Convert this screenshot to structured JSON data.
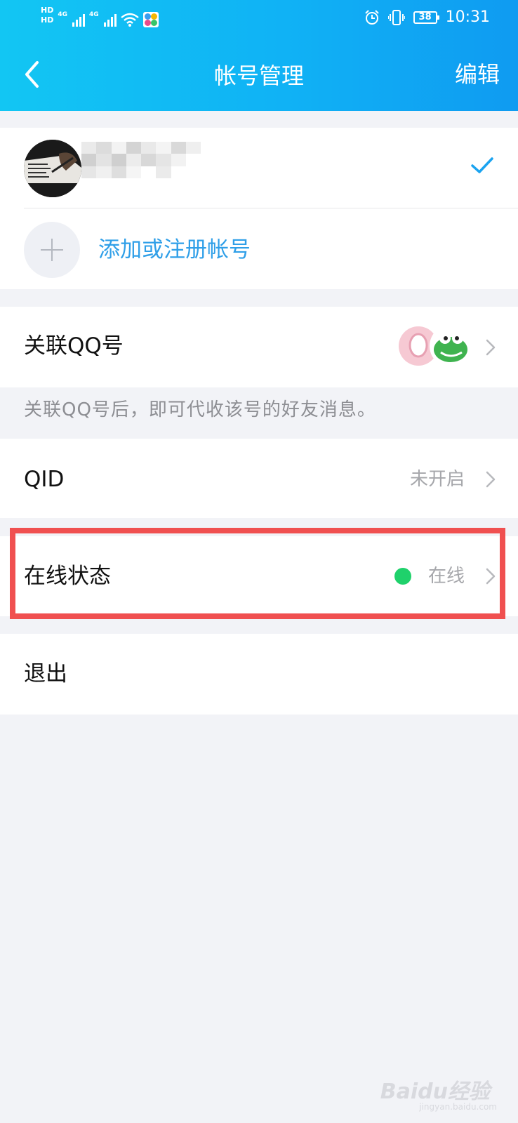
{
  "status_bar": {
    "hd1": "HD",
    "hd2": "HD",
    "net1": "4G",
    "net2": "4G",
    "battery": "38",
    "time": "10:31"
  },
  "nav": {
    "title": "帐号管理",
    "edit_label": "编辑",
    "back_icon": "back-arrow-icon"
  },
  "account": {
    "selected_icon": "checkmark-icon",
    "add_label": "添加或注册帐号"
  },
  "associated_qq": {
    "label": "关联QQ号",
    "hint": "关联QQ号后，即可代收该号的好友消息。"
  },
  "qid": {
    "label": "QID",
    "value": "未开启"
  },
  "online_status": {
    "label": "在线状态",
    "value": "在线",
    "dot_color": "#1fd16b"
  },
  "logout": {
    "label": "退出"
  },
  "colors": {
    "header_gradient_start": "#12c6f3",
    "header_gradient_end": "#0f9bf1",
    "accent_blue": "#2f9fe8",
    "highlight_red": "#f05050",
    "background": "#f2f3f7"
  },
  "watermark": {
    "text": "Baidu经验",
    "sub": "jingyan.baidu.com"
  }
}
